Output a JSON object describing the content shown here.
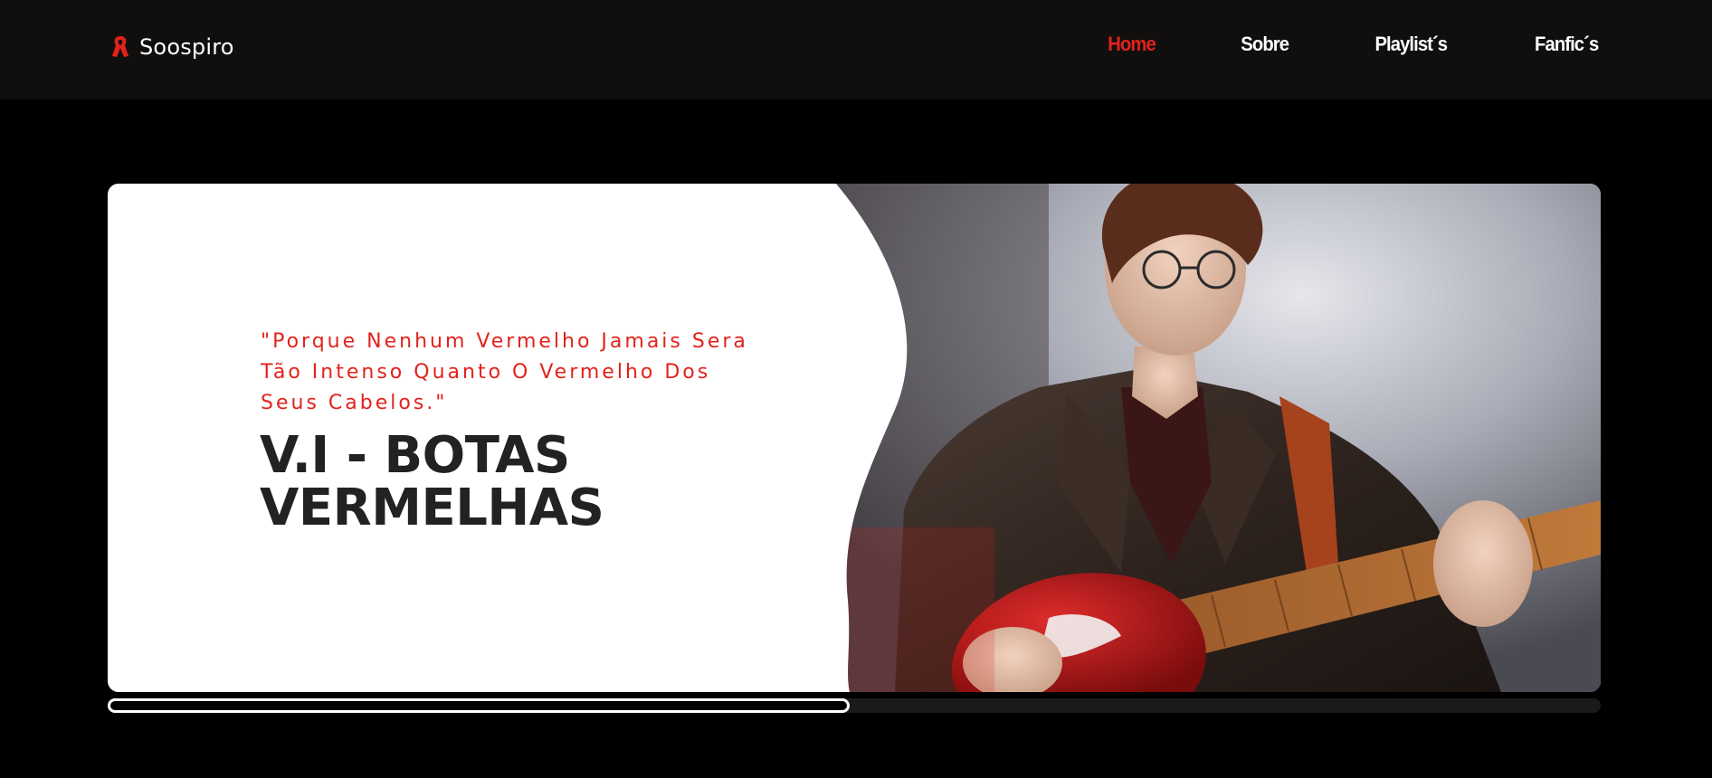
{
  "brand": {
    "name": "Soospiro",
    "icon": "red-ribbon-icon"
  },
  "nav": {
    "items": [
      {
        "label": "Home",
        "active": true
      },
      {
        "label": "Sobre",
        "active": false
      },
      {
        "label": "Playlist´s",
        "active": false
      },
      {
        "label": "Fanfic´s",
        "active": false
      }
    ]
  },
  "hero": {
    "quote": "\"Porque Nenhum Vermelho Jamais Sera Tão Intenso Quanto O Vermelho Dos Seus Cabelos.\"",
    "title_line1": "V.I - BOTAS",
    "title_line2": "VERMELHAS",
    "image": "guitarist-photo"
  },
  "slider": {
    "progress": 0.497
  },
  "colors": {
    "accent": "#e3221c",
    "header_bg": "#100f0e",
    "page_bg": "#000000",
    "title": "#222222"
  }
}
